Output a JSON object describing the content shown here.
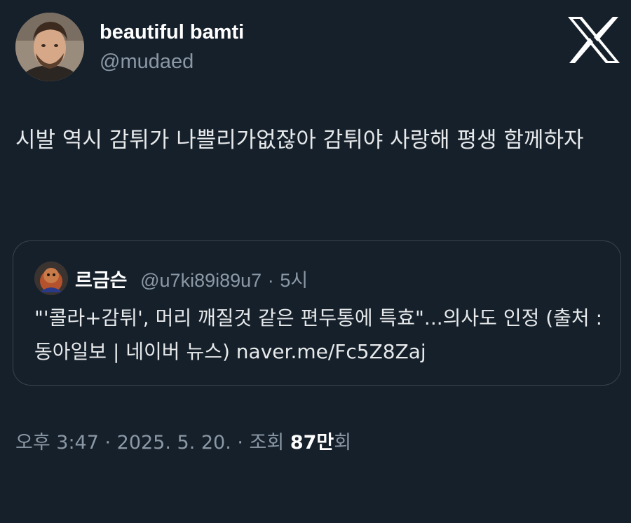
{
  "author": {
    "display_name": "beautiful bamti",
    "handle": "@mudaed",
    "avatar_icon": "profile-photo"
  },
  "platform_logo": "x-logo-icon",
  "tweet": {
    "text": "시발 역시 감튀가 나쁠리가없잖아 감튀야 사랑해 평생 함께하자"
  },
  "quote": {
    "name": "르금슨",
    "handle": "@u7ki89i89u7",
    "separator": "·",
    "time": "5시",
    "text": "\"'콜라+감튀', 머리 깨질것 같은 편두통에 특효\"...의사도 인정 (출처 : 동아일보 | 네이버 뉴스) naver.me/Fc5Z8Zaj"
  },
  "meta": {
    "prefix": "오후 3:47 · 2025. 5. 20. · 조회 ",
    "views": "87만",
    "suffix": "회"
  },
  "colors": {
    "background": "#15202b",
    "text_primary": "#e7e9ea",
    "text_secondary": "#8b98a5",
    "border": "#38444d"
  }
}
